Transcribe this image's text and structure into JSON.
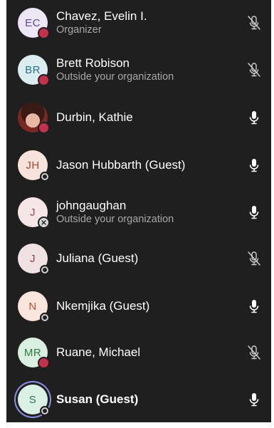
{
  "participants": [
    {
      "initials": "EC",
      "name": "Chavez, Evelin I.",
      "subtitle": "Organizer",
      "status": "busy",
      "mic": "muted",
      "avatar_style": "ava-c0"
    },
    {
      "initials": "BR",
      "name": "Brett Robison",
      "subtitle": "Outside your organization",
      "status": "busy",
      "mic": "muted",
      "avatar_style": "ava-c1"
    },
    {
      "initials": "",
      "name": "Durbin, Kathie",
      "subtitle": "",
      "status": "busy",
      "mic": "on",
      "avatar_style": "photo"
    },
    {
      "initials": "JH",
      "name": "Jason Hubbarth (Guest)",
      "subtitle": "",
      "status": "offline",
      "mic": "on",
      "avatar_style": "ava-c3"
    },
    {
      "initials": "J",
      "name": "johngaughan",
      "subtitle": "Outside your organization",
      "status": "unknown",
      "mic": "on",
      "avatar_style": "ava-c4"
    },
    {
      "initials": "J",
      "name": "Juliana (Guest)",
      "subtitle": "",
      "status": "offline",
      "mic": "muted",
      "avatar_style": "ava-c5"
    },
    {
      "initials": "N",
      "name": "Nkemjika (Guest)",
      "subtitle": "",
      "status": "offline",
      "mic": "on",
      "avatar_style": "ava-c6"
    },
    {
      "initials": "MR",
      "name": "Ruane, Michael",
      "subtitle": "",
      "status": "busy",
      "mic": "muted",
      "avatar_style": "ava-c7"
    },
    {
      "initials": "S",
      "name": "Susan (Guest)",
      "subtitle": "",
      "status": "offline",
      "mic": "on",
      "avatar_style": "ava-c8",
      "speaking": true,
      "bold": true
    }
  ],
  "colors": {
    "panel_bg": "#1f1f1f",
    "busy": "#c4314b",
    "speaking_ring": "#8a8ee6",
    "subtitle": "#a8a8a8"
  },
  "icons": {
    "mic_on": "microphone-icon",
    "mic_muted": "microphone-muted-icon",
    "status_unknown": "x-icon"
  }
}
